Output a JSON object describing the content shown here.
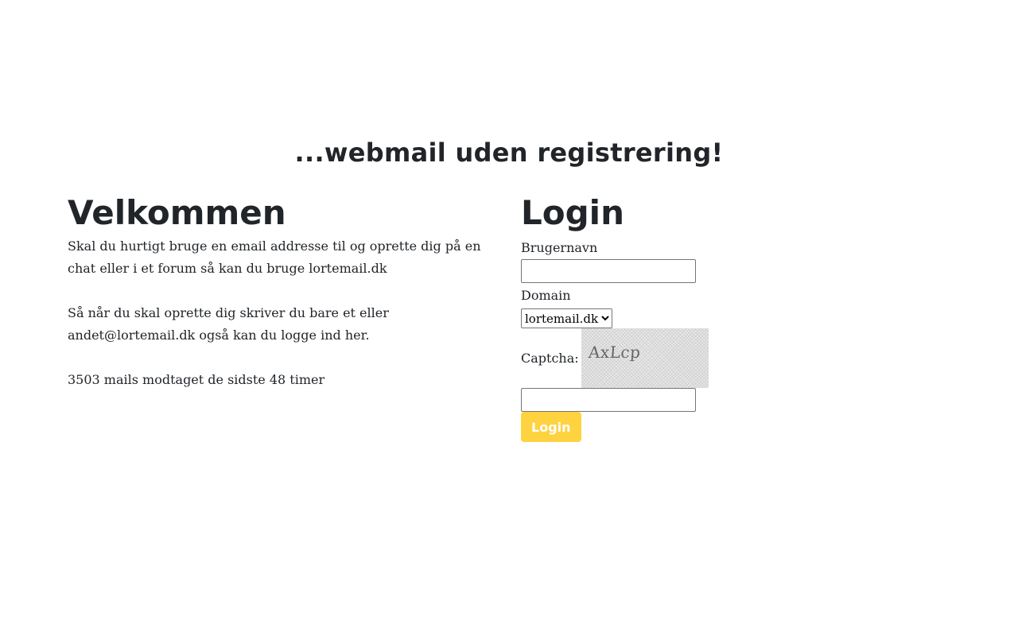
{
  "tagline": "...webmail uden registrering!",
  "welcome": {
    "heading": "Velkommen",
    "paragraph1": "Skal du hurtigt bruge en email addresse til og oprette dig på en chat eller i et forum så kan du bruge lortemail.dk",
    "paragraph2": "Så når du skal oprette dig skriver du bare et eller andet@lortemail.dk også kan du logge ind her.",
    "stats": "3503 mails modtaget de sidste 48 timer"
  },
  "login": {
    "heading": "Login",
    "username_label": "Brugernavn",
    "username_value": "",
    "domain_label": "Domain",
    "domain_selected": "lortemail.dk",
    "captcha_label": "Captcha:",
    "captcha_text": "AxLcp",
    "captcha_value": "",
    "button_label": "Login",
    "button_color": "#ffd23f"
  }
}
